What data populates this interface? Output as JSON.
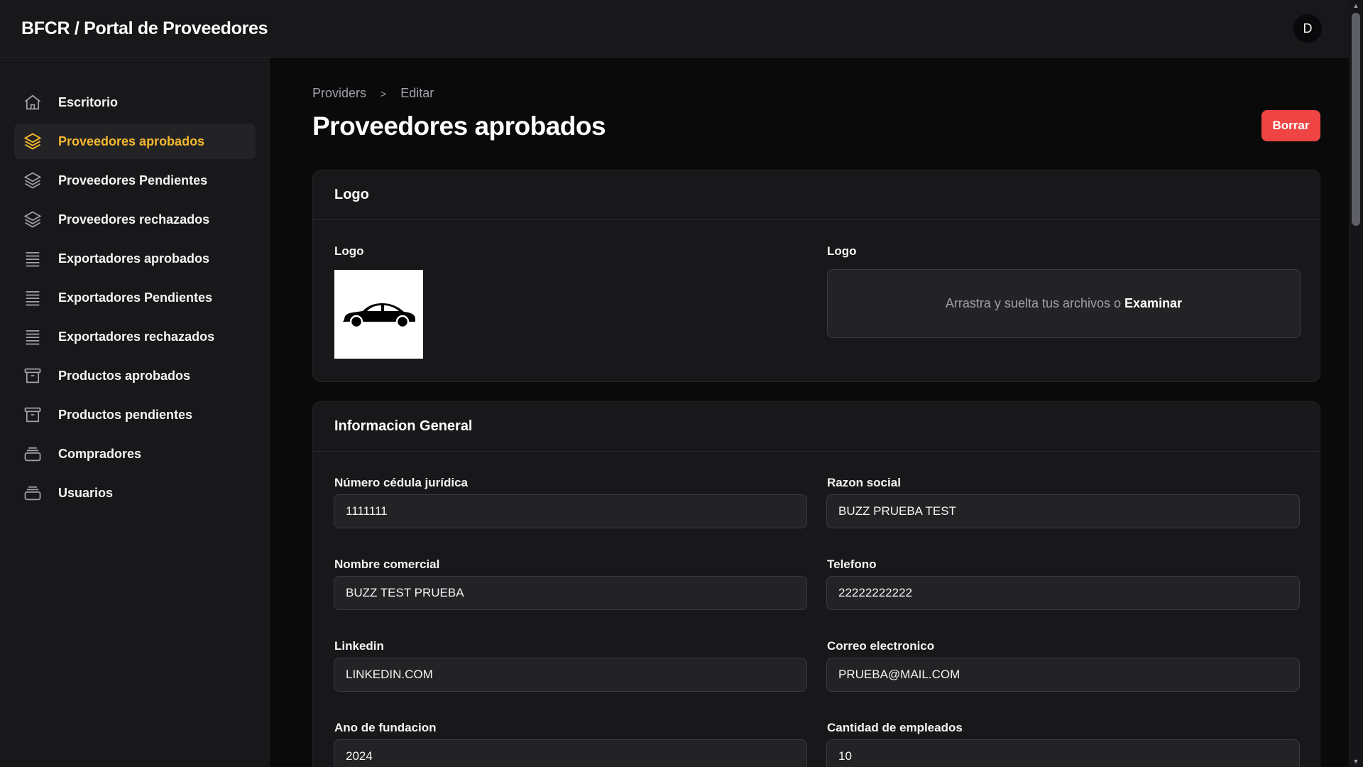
{
  "header": {
    "title": "BFCR / Portal de Proveedores",
    "avatar_initial": "D"
  },
  "sidebar": {
    "items": [
      {
        "label": "Escritorio",
        "icon": "home-icon",
        "active": false
      },
      {
        "label": "Proveedores aprobados",
        "icon": "layers-icon",
        "active": true
      },
      {
        "label": "Proveedores Pendientes",
        "icon": "layers-icon",
        "active": false
      },
      {
        "label": "Proveedores rechazados",
        "icon": "layers-icon",
        "active": false
      },
      {
        "label": "Exportadores aprobados",
        "icon": "list-icon",
        "active": false
      },
      {
        "label": "Exportadores Pendientes",
        "icon": "list-icon",
        "active": false
      },
      {
        "label": "Exportadores rechazados",
        "icon": "list-icon",
        "active": false
      },
      {
        "label": "Productos aprobados",
        "icon": "archive-icon",
        "active": false
      },
      {
        "label": "Productos pendientes",
        "icon": "archive-icon",
        "active": false
      },
      {
        "label": "Compradores",
        "icon": "stack-icon",
        "active": false
      },
      {
        "label": "Usuarios",
        "icon": "stack-icon",
        "active": false
      }
    ]
  },
  "breadcrumb": {
    "parent": "Providers",
    "separator": ">",
    "current": "Editar"
  },
  "page": {
    "title": "Proveedores aprobados",
    "delete_label": "Borrar"
  },
  "logo_section": {
    "title": "Logo",
    "current_label": "Logo",
    "upload_label": "Logo",
    "dropzone_text": "Arrastra y suelta tus archivos o",
    "dropzone_browse": "Examinar",
    "logo_image_icon": "car-icon"
  },
  "general_section": {
    "title": "Informacion General",
    "fields": {
      "cedula": {
        "label": "Número cédula jurídica",
        "value": "1111111"
      },
      "razon_social": {
        "label": "Razon social",
        "value": "BUZZ PRUEBA TEST"
      },
      "nombre_comercial": {
        "label": "Nombre comercial",
        "value": "BUZZ TEST PRUEBA"
      },
      "telefono": {
        "label": "Telefono",
        "value": "22222222222"
      },
      "linkedin": {
        "label": "Linkedin",
        "value": "LINKEDIN.COM"
      },
      "correo": {
        "label": "Correo electronico",
        "value": "PRUEBA@MAIL.COM"
      },
      "ano_fundacion": {
        "label": "Ano de fundacion",
        "value": "2024"
      },
      "cantidad_empleados": {
        "label": "Cantidad de empleados",
        "value": "10"
      }
    }
  },
  "colors": {
    "accent": "#f5b82e",
    "danger": "#ef4444",
    "surface": "#18181b",
    "background": "#0a0a0b"
  }
}
